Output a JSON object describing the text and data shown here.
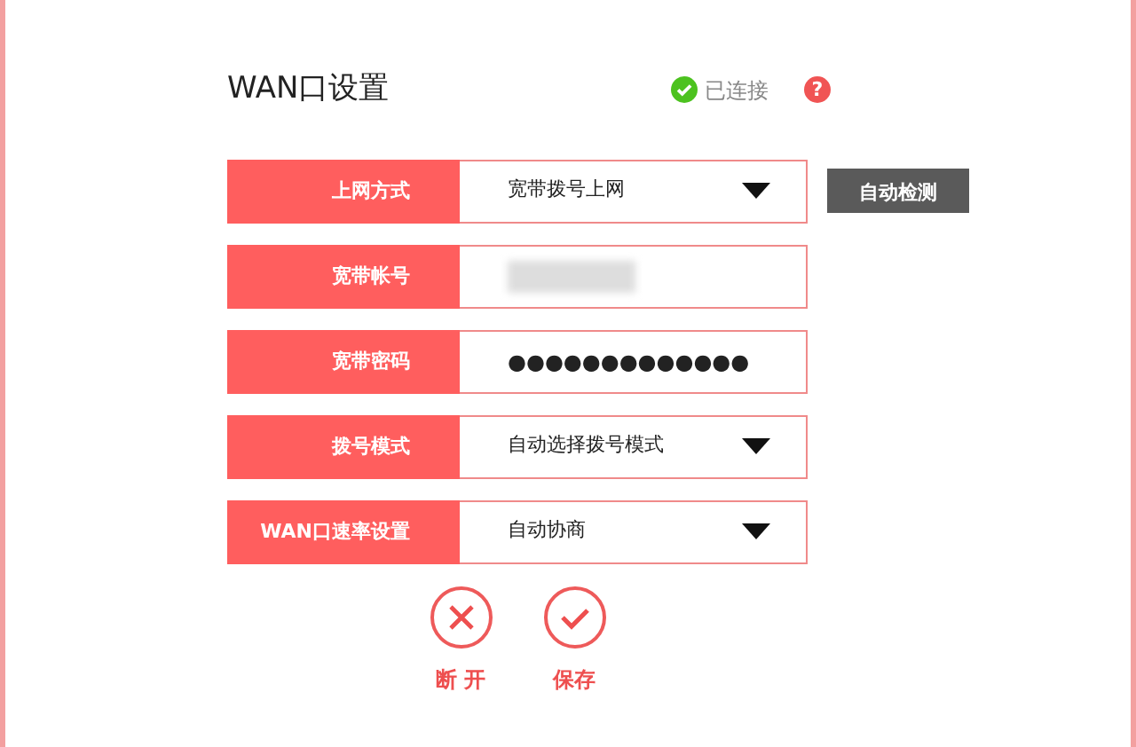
{
  "title": "WAN口设置",
  "status": {
    "label": "已连接",
    "connected": true
  },
  "help": "?",
  "fields": [
    {
      "label": "上网方式",
      "kind": "select",
      "value": "宽带拨号上网"
    },
    {
      "label": "宽带帐号",
      "kind": "redacted"
    },
    {
      "label": "宽带密码",
      "kind": "password",
      "value": "●●●●●●●●●●●●●"
    },
    {
      "label": "拨号模式",
      "kind": "select",
      "value": "自动选择拨号模式"
    },
    {
      "label": "WAN口速率设置",
      "kind": "select",
      "value": "自动协商"
    }
  ],
  "detect_button": "自动检测",
  "actions": [
    {
      "kind": "disconnect",
      "label": "断 开"
    },
    {
      "kind": "save",
      "label": "保存"
    }
  ]
}
